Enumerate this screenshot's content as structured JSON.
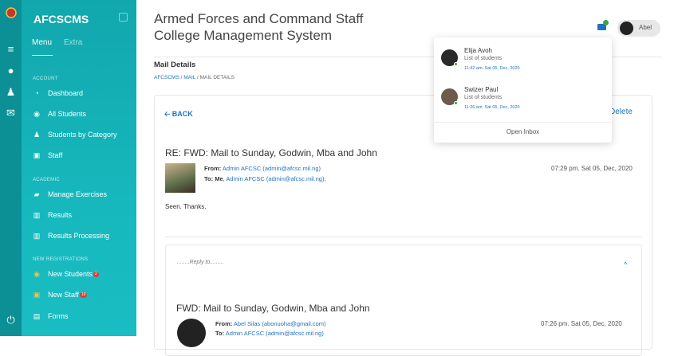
{
  "app": {
    "short_name": "AFCSCMS",
    "title_line1": "Armed Forces and Command Staff",
    "title_line2": "College Management System"
  },
  "sidebar": {
    "tabs": [
      "Menu",
      "Extra"
    ],
    "sections": {
      "account": "ACCOUNT",
      "academic": "ACADEMIC",
      "registrations": "NEW REGISTRATIONS"
    },
    "items": [
      {
        "label": "Dashboard",
        "icon": "dashboard-icon"
      },
      {
        "label": "All Students",
        "icon": "user-circle-icon"
      },
      {
        "label": "Students by Category",
        "icon": "users-icon"
      },
      {
        "label": "Staff",
        "icon": "id-card-icon"
      },
      {
        "label": "Manage Exercises",
        "icon": "book-icon"
      },
      {
        "label": "Results",
        "icon": "bar-chart-icon"
      },
      {
        "label": "Results Processing",
        "icon": "bar-chart-icon"
      },
      {
        "label": "New Students",
        "icon": "user-circle-icon",
        "badge": "2"
      },
      {
        "label": "New Staff",
        "icon": "id-card-icon",
        "badge": "10"
      },
      {
        "label": "Forms",
        "icon": "list-icon"
      }
    ]
  },
  "header": {
    "user_name": "Abel"
  },
  "page": {
    "title": "Mail Details",
    "breadcrumb": [
      "AFCSCMS",
      "MAIL",
      "MAIL DETAILS"
    ],
    "sep": "/"
  },
  "mail": {
    "back_label": "BACK",
    "delete_label": "Delete",
    "subject": "RE: FWD: Mail to Sunday, Godwin, Mba and John",
    "from_label": "From:",
    "from": "Admin AFCSC (admin@afcsc.mil.ng)",
    "to_label": "To:",
    "to_me": "Me",
    "to": "Admin AFCSC (admin@afcsc.mil.ng);",
    "date": "07:29 pm. Sat 05, Dec, 2020",
    "body": "Seen. Thanks."
  },
  "reply": {
    "label": "........Reply to.........",
    "subject": "FWD: Mail to Sunday, Godwin, Mba and John",
    "from_label": "From:",
    "from": "Abel Silas (abonuoha@gmail.com)",
    "to_label": "To:",
    "to": "Admin AFCSC (admin@afcsc.mil.ng)",
    "date": "07:26 pm. Sat 05, Dec, 2020"
  },
  "notifications": {
    "items": [
      {
        "name": "Elija Avoh",
        "subject": "List of students",
        "time": "11:42 am. Sat 05, Dec, 2020"
      },
      {
        "name": "Swizer Paul",
        "subject": "List of students",
        "time": "11:26 am. Sat 05, Dec, 2020"
      }
    ],
    "open_label": "Open Inbox"
  },
  "colors": {
    "sidebar": "#16b8bd",
    "rail": "#0d8f96",
    "link": "#1e73be",
    "badge": "#e53935",
    "online": "#43a047"
  }
}
